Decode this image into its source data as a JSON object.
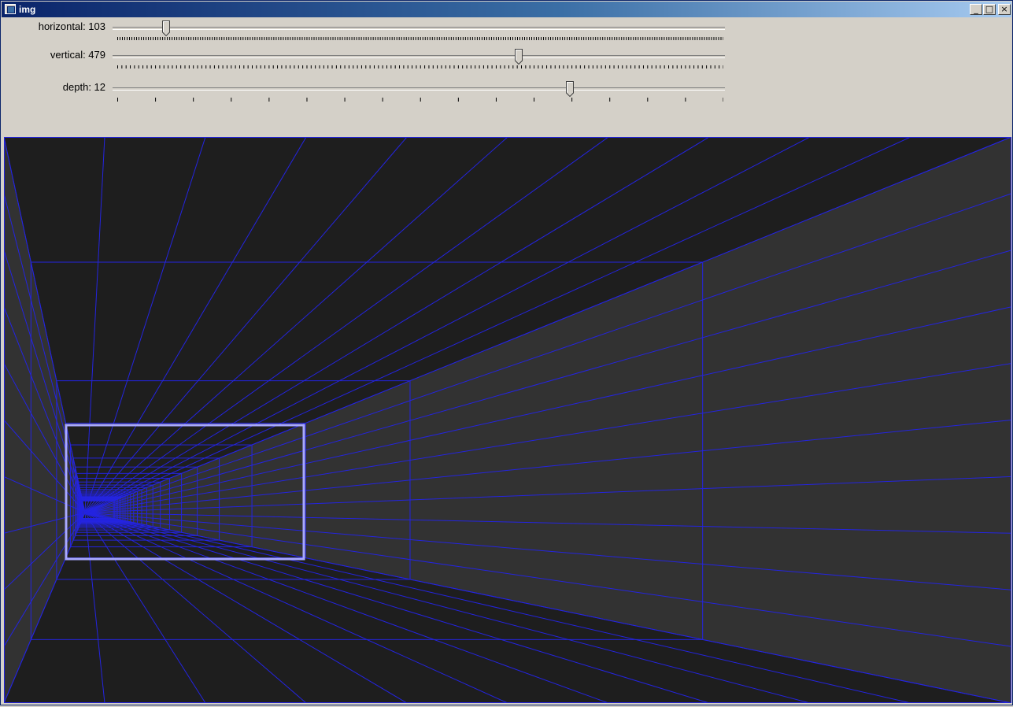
{
  "window": {
    "title": "img",
    "buttons": {
      "minimize": "_",
      "maximize": "□",
      "close": "×"
    }
  },
  "controls": {
    "horizontal": {
      "label": "horizontal: 103",
      "value": 103,
      "min": 0,
      "max": 1280
    },
    "vertical": {
      "label": "vertical: 479",
      "value": 479,
      "min": 0,
      "max": 719
    },
    "depth": {
      "label": "depth: 12",
      "value": 12,
      "min": 0,
      "max": 16
    }
  },
  "colors": {
    "grid_line": "#2424e0",
    "highlight_rect": "#a8a8ff",
    "floor_ceiling": "#1e1e1e",
    "wall": "#323232",
    "window_bg": "#d4d0c8",
    "titlebar_start": "#0a246a",
    "titlebar_end": "#a6caf0"
  },
  "icons": {
    "app": "window-app-icon",
    "minimize": "minimize-icon",
    "maximize": "maximize-icon",
    "close": "close-icon",
    "slider_thumb": "slider-thumb-icon"
  }
}
